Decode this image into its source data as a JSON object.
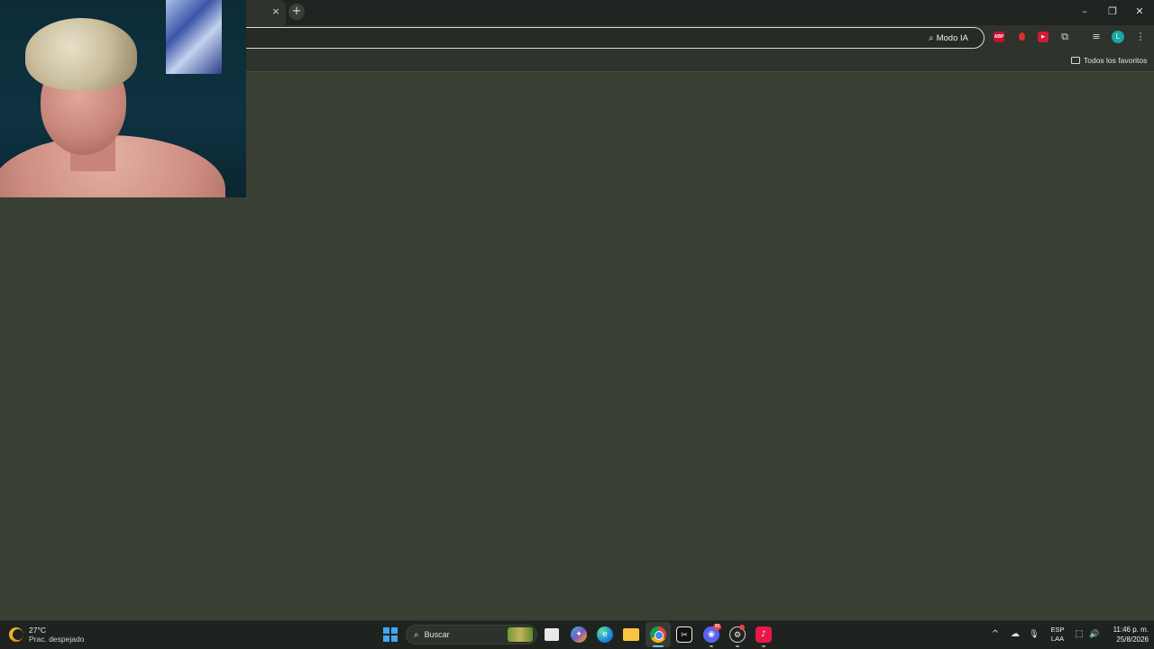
{
  "browser": {
    "tab_close_glyph": "×",
    "new_tab_glyph": "+",
    "window_controls": {
      "minimize": "–",
      "restore": "❐",
      "close": "✕"
    },
    "omnibox": {
      "value": "",
      "placeholder": ""
    },
    "modo_ia": {
      "icon": "search-spark-icon",
      "label": "Modo IA"
    },
    "extensions": [
      {
        "name": "adblock-plus",
        "label": "ABP",
        "color": "#c8102e"
      },
      {
        "name": "blood-drop",
        "label": "",
        "color": "#e02d2d"
      },
      {
        "name": "red-extension",
        "label": "▶",
        "color": "#d31b36"
      }
    ],
    "puzzle_glyph": "⧉",
    "media_glyph": "≡",
    "profile_initial": "L",
    "menu_glyph": "⋮",
    "bookmarks": {
      "all_label": "Todos los favoritos"
    }
  },
  "taskbar": {
    "weather": {
      "temperature": "27°C",
      "condition": "Prac. despejado"
    },
    "search_label": "Buscar",
    "search_glyph": "⌕",
    "apps": {
      "capcut_glyph": "✂",
      "discord_glyph": "◉",
      "discord_badge": "99",
      "steam_glyph": "⚙",
      "tiktok_glyph": "♪",
      "edge_glyph": "e",
      "copilot_glyph": "✦"
    },
    "tray": {
      "overflow_glyph": "^",
      "onedrive_glyph": "☁",
      "mic_glyph": "🎙",
      "language_top": "ESP",
      "language_bottom": "LAA",
      "network_glyph": "⬚",
      "volume_glyph": "🔊",
      "time": "11:46 p. m.",
      "date": "25/8/2026"
    }
  },
  "colors": {
    "page_bg": "#3a3f34",
    "chrome_bg": "#2f332d",
    "tabstrip_bg": "#202420",
    "taskbar_bg": "#1f231f",
    "accent_start": "#3fa7f5"
  }
}
